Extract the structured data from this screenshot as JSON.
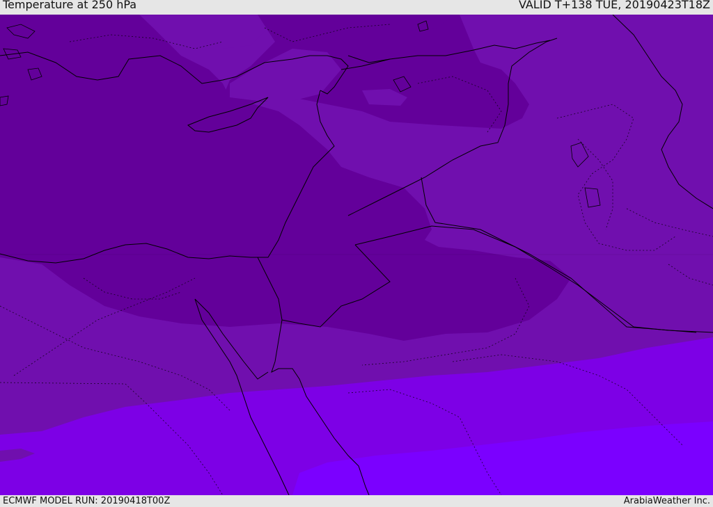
{
  "header": {
    "title": "Temperature at 250 hPa",
    "valid": "VALID T+138 TUE, 20190423T18Z"
  },
  "footer": {
    "model_run": "ECMWF MODEL RUN: 20190418T00Z",
    "credit": "ArabiaWeather Inc."
  },
  "colors": {
    "band_darkest": "#63009a",
    "band_dark": "#700fae",
    "band_mid": "#7700cc",
    "band_bright": "#7d00e6",
    "band_brightest": "#7b00ff",
    "coastline": "#000000"
  }
}
